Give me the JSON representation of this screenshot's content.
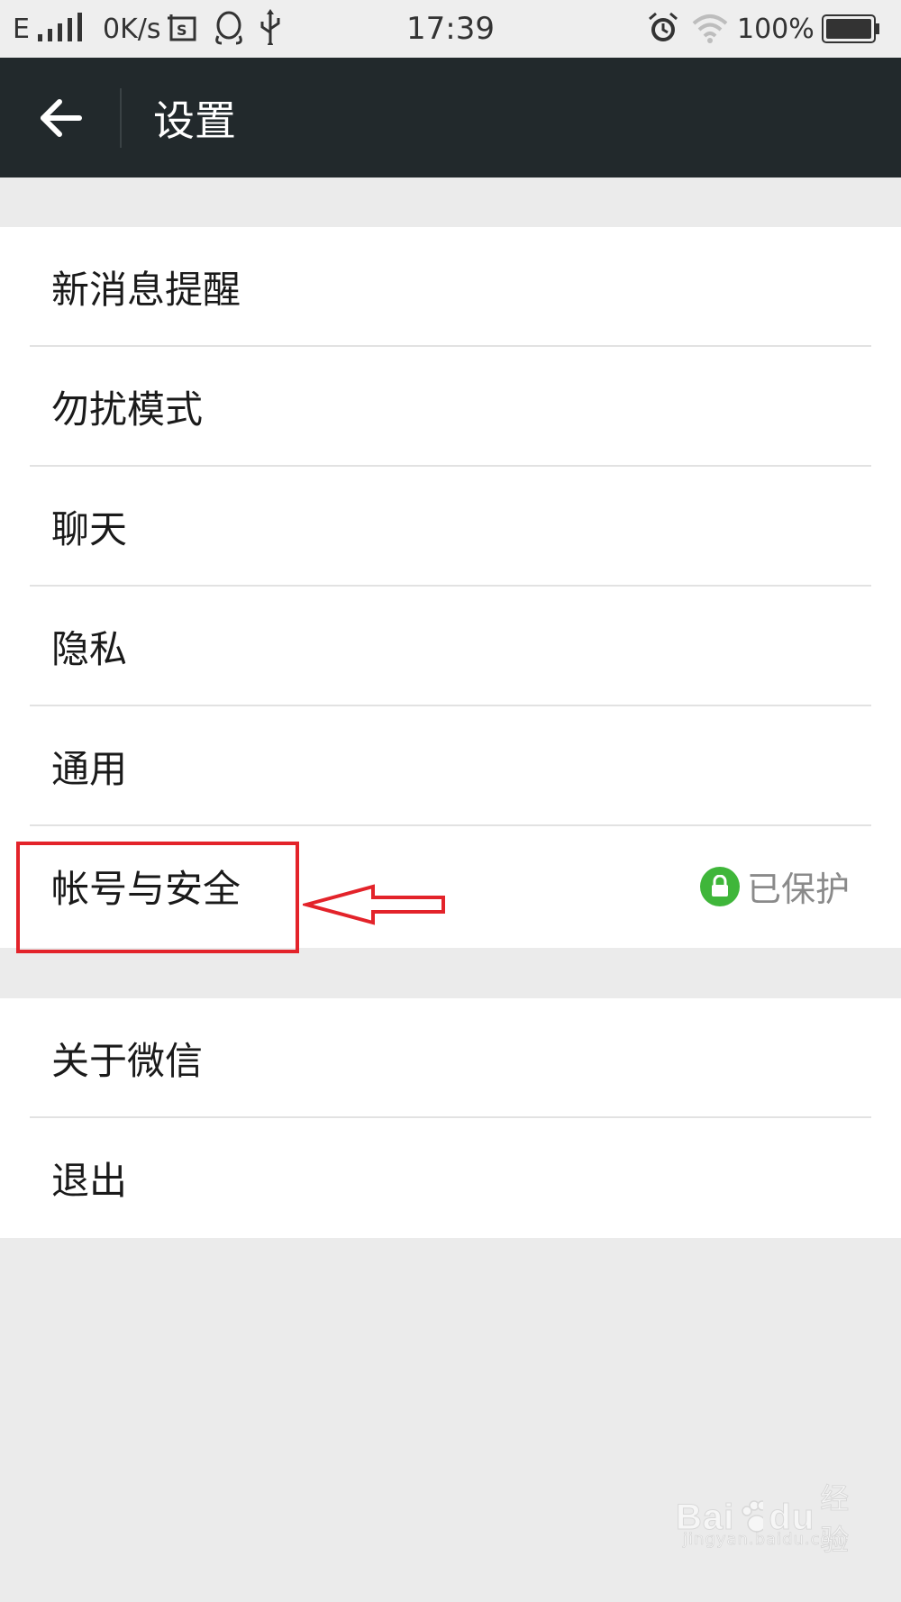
{
  "status_bar": {
    "network_type": "E",
    "net_speed": "0K/s",
    "time": "17:39",
    "battery_percent": "100%",
    "icons": [
      "signal-icon",
      "screenshot-icon",
      "qq-icon",
      "usb-icon",
      "alarm-icon",
      "wifi-icon",
      "battery-icon"
    ]
  },
  "header": {
    "back_icon": "back-arrow-icon",
    "title": "设置",
    "background_color": "#22292c"
  },
  "settings": {
    "group1": [
      {
        "label": "新消息提醒"
      },
      {
        "label": "勿扰模式"
      },
      {
        "label": "聊天"
      },
      {
        "label": "隐私"
      },
      {
        "label": "通用"
      },
      {
        "label": "帐号与安全",
        "status": "已保护",
        "status_icon": "lock-icon",
        "status_color": "#3fb63a"
      }
    ],
    "group2": [
      {
        "label": "关于微信"
      },
      {
        "label": "退出"
      }
    ]
  },
  "annotation": {
    "highlight_color": "#e3232a",
    "arrow": "left-pointing-arrow"
  },
  "watermark": {
    "brand": "Bai",
    "brand_suffix": "du",
    "label": "经验",
    "url": "jingyan.baidu.com"
  }
}
